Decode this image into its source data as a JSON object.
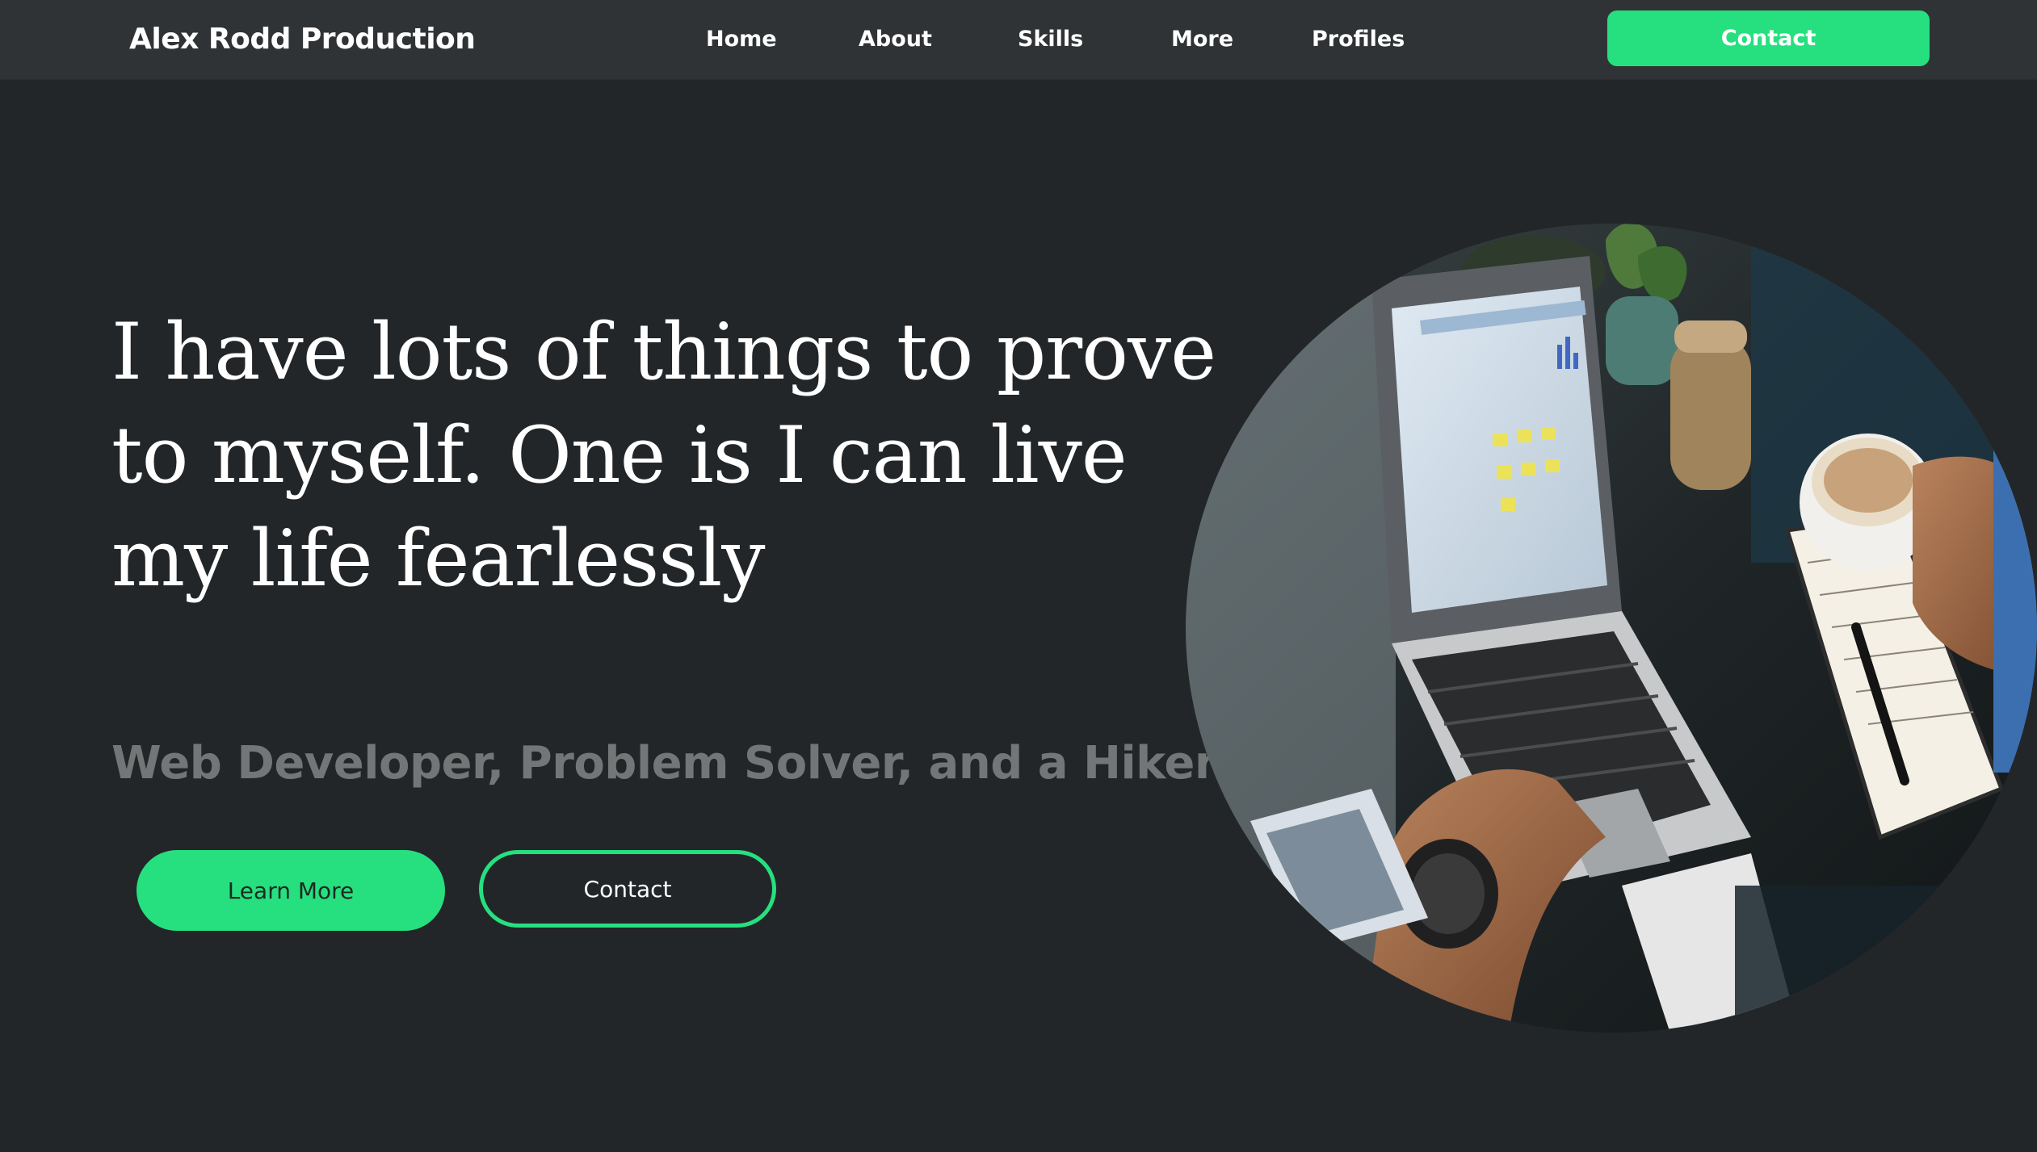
{
  "nav": {
    "brand": "Alex Rodd Production",
    "links": [
      "Home",
      "About",
      "Skills",
      "More",
      "Profiles"
    ],
    "cta": "Contact"
  },
  "hero": {
    "headline": "I have lots of things to prove to myself. One is I can live my life fearlessly",
    "subhead": "Web Developer, Problem Solver, and a Hiker",
    "primary_button": "Learn More",
    "secondary_button": "Contact",
    "image_subject": "person working on laptop with coffee"
  },
  "colors": {
    "background": "#232628",
    "navbar": "#2f3335",
    "accent": "#26e07f",
    "subhead": "#737677"
  }
}
